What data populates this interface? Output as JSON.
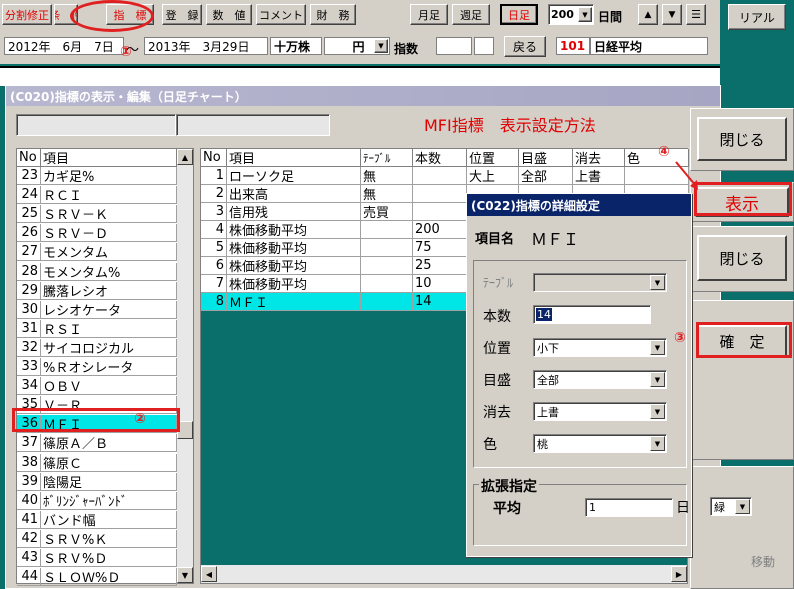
{
  "toolbar": {
    "items": [
      "分割修正",
      "条　件",
      "指　標",
      "登　録",
      "数　値",
      "コメント",
      "財　務",
      "月足",
      "週足",
      "日足"
    ],
    "count_value": "200",
    "period_label": "日間",
    "realtime_label": "リアル"
  },
  "daterow": {
    "start_date": "2012年　6月　7日",
    "tilde": "～",
    "end_date": "2013年　3月29日",
    "unit_label": "十万株",
    "currency": "円",
    "index_label": "指数",
    "back_button": "戻る",
    "index_code": "101",
    "index_name": "日経平均"
  },
  "window": {
    "title": "(C020)指標の表示・編集（日足チャート）",
    "heading": "MFI指標　表示設定方法"
  },
  "left_list": {
    "headers": [
      "No",
      "項目"
    ],
    "rows": [
      [
        "23",
        "カギ足%"
      ],
      [
        "24",
        "ＲＣＩ"
      ],
      [
        "25",
        "ＳＲＶ－Ｋ"
      ],
      [
        "26",
        "ＳＲＶ－Ｄ"
      ],
      [
        "27",
        "モメンタム"
      ],
      [
        "28",
        "モメンタム%"
      ],
      [
        "29",
        "騰落レシオ"
      ],
      [
        "30",
        "レシオケータ"
      ],
      [
        "31",
        "ＲＳＩ"
      ],
      [
        "32",
        "サイコロジカル"
      ],
      [
        "33",
        "%Ｒオシレータ"
      ],
      [
        "34",
        "ＯＢＶ"
      ],
      [
        "35",
        "Ｖ－Ｒ"
      ],
      [
        "36",
        "ＭＦＩ"
      ],
      [
        "37",
        "篠原Ａ／Ｂ"
      ],
      [
        "38",
        "篠原Ｃ"
      ],
      [
        "39",
        "陰陽足"
      ],
      [
        "40",
        "ﾎﾞﾘﾝｼﾞｬｰﾊﾞﾝﾄﾞ"
      ],
      [
        "41",
        "バンド幅"
      ],
      [
        "42",
        "ＳＲＶ%Ｋ"
      ],
      [
        "43",
        "ＳＲＶ%Ｄ"
      ],
      [
        "44",
        "ＳＬＯＷ%Ｄ"
      ]
    ]
  },
  "main_table": {
    "headers": [
      "No",
      "項目",
      "ﾃｰﾌﾞﾙ",
      "本数",
      "位置",
      "目盛",
      "消去",
      "色"
    ],
    "rows": [
      [
        "1",
        "ローソク足",
        "無",
        "",
        "大上",
        "全部",
        "上書",
        ""
      ],
      [
        "2",
        "出来高",
        "無",
        "",
        "",
        "",
        "",
        ""
      ],
      [
        "3",
        "信用残",
        "売買",
        "",
        "",
        "",
        "",
        ""
      ],
      [
        "4",
        "株価移動平均",
        "",
        "200",
        "",
        "",
        "",
        ""
      ],
      [
        "5",
        "株価移動平均",
        "",
        "75",
        "",
        "",
        "",
        ""
      ],
      [
        "6",
        "株価移動平均",
        "",
        "25",
        "",
        "",
        "",
        ""
      ],
      [
        "7",
        "株価移動平均",
        "",
        "10",
        "",
        "",
        "",
        ""
      ],
      [
        "8",
        "ＭＦＩ",
        "",
        "14",
        "",
        "",
        "",
        ""
      ]
    ]
  },
  "right_buttons": {
    "close1": "閉じる",
    "display": "表示",
    "close2": "閉じる",
    "confirm": "確　定",
    "move": "移動"
  },
  "dialog": {
    "title": "(C022)指標の詳細設定",
    "item_label": "項目名",
    "item_value": "ＭＦＩ",
    "table_label": "ﾃｰﾌﾞﾙ",
    "count_label": "本数",
    "count_value": "14",
    "position_label": "位置",
    "position_value": "小下",
    "scale_label": "目盛",
    "scale_value": "全部",
    "erase_label": "消去",
    "erase_value": "上書",
    "color_label": "色",
    "color_value": "桃",
    "ext_label": "拡張指定",
    "avg_label": "平均",
    "avg_value": "1",
    "day_label": "日",
    "avg_color": "緑"
  },
  "annotations": {
    "a1": "①",
    "a2": "②",
    "a3": "③",
    "a4": "④"
  },
  "colors": {
    "desktop": "#0a6f6b",
    "selection": "#00e5e5",
    "annotation": "#e02020",
    "dialog_title": "#0a246a"
  }
}
